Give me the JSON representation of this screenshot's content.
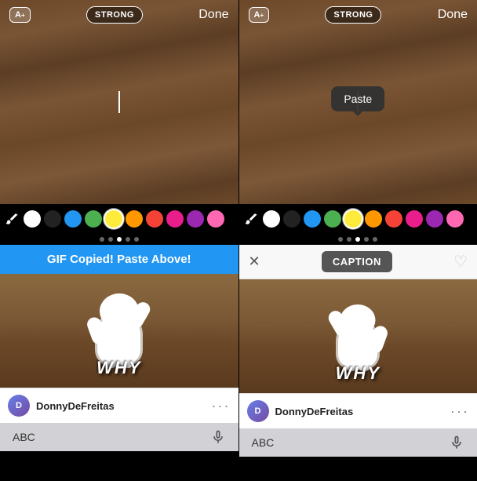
{
  "panels": [
    {
      "id": "left",
      "editor": {
        "font_size_label": "A",
        "style_label": "STRONG",
        "done_label": "Done"
      },
      "colors": [
        {
          "color": "#FFFFFF",
          "selected": false
        },
        {
          "color": "#222222",
          "selected": false
        },
        {
          "color": "#2196F3",
          "selected": false
        },
        {
          "color": "#4CAF50",
          "selected": false
        },
        {
          "color": "#FFEB3B",
          "selected": true
        },
        {
          "color": "#FF9800",
          "selected": false
        },
        {
          "color": "#F44336",
          "selected": false
        },
        {
          "color": "#E91E8C",
          "selected": false
        },
        {
          "color": "#9C27B0",
          "selected": false
        },
        {
          "color": "#FF69B4",
          "selected": false
        }
      ],
      "notification": "GIF Copied! Paste Above!",
      "gif_card": {
        "why_text": "WHY",
        "username": "DonnyDeFreitas"
      },
      "keyboard": {
        "abc": "ABC"
      }
    },
    {
      "id": "right",
      "editor": {
        "font_size_label": "A",
        "style_label": "STRONG",
        "done_label": "Done",
        "paste_label": "Paste"
      },
      "colors": [
        {
          "color": "#FFFFFF",
          "selected": false
        },
        {
          "color": "#222222",
          "selected": false
        },
        {
          "color": "#2196F3",
          "selected": false
        },
        {
          "color": "#4CAF50",
          "selected": false
        },
        {
          "color": "#FFEB3B",
          "selected": true
        },
        {
          "color": "#FF9800",
          "selected": false
        },
        {
          "color": "#F44336",
          "selected": false
        },
        {
          "color": "#E91E8C",
          "selected": false
        },
        {
          "color": "#9C27B0",
          "selected": false
        },
        {
          "color": "#FF69B4",
          "selected": false
        }
      ],
      "caption_bar": {
        "caption_label": "CAPTION"
      },
      "gif_card": {
        "why_text": "WHY",
        "username": "DonnyDeFreitas"
      },
      "keyboard": {
        "abc": "ABC"
      }
    }
  ],
  "dots": [
    {
      "active": false
    },
    {
      "active": false
    },
    {
      "active": true
    },
    {
      "active": false
    },
    {
      "active": false
    }
  ]
}
